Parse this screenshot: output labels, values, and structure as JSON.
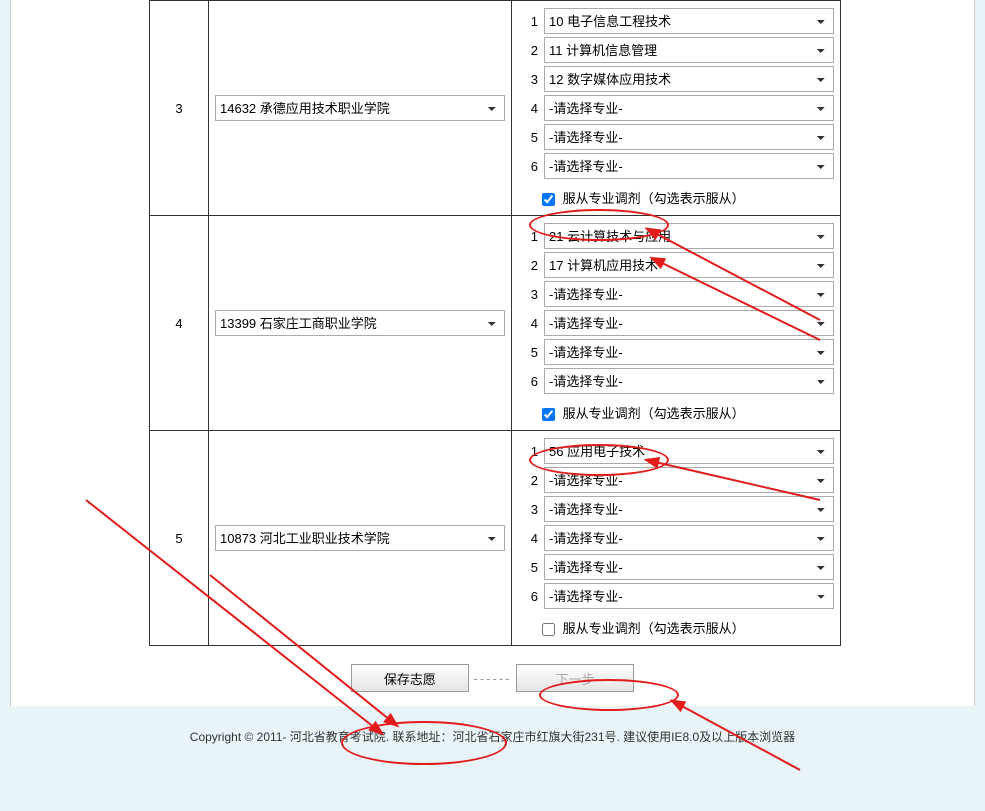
{
  "placeholder_major": "-请选择专业-",
  "adjust_label": "服从专业调剂（勾选表示服从）",
  "rows": [
    {
      "num": "3",
      "school": "14632 承德应用技术职业学院",
      "majors": [
        "10 电子信息工程技术",
        "11 计算机信息管理",
        "12 数字媒体应用技术",
        "-请选择专业-",
        "-请选择专业-",
        "-请选择专业-"
      ],
      "adjust_checked": true
    },
    {
      "num": "4",
      "school": "13399 石家庄工商职业学院",
      "majors": [
        "21 云计算技术与应用",
        "17 计算机应用技术",
        "-请选择专业-",
        "-请选择专业-",
        "-请选择专业-",
        "-请选择专业-"
      ],
      "adjust_checked": true
    },
    {
      "num": "5",
      "school": "10873 河北工业职业技术学院",
      "majors": [
        "56 应用电子技术",
        "-请选择专业-",
        "-请选择专业-",
        "-请选择专业-",
        "-请选择专业-",
        "-请选择专业-"
      ],
      "adjust_checked": false
    }
  ],
  "buttons": {
    "save": "保存志愿",
    "next": "下一步"
  },
  "footer": "Copyright © 2011-  河北省教育考试院. 联系地址：河北省石家庄市红旗大街231号. 建议使用IE8.0及以上版本浏览器"
}
